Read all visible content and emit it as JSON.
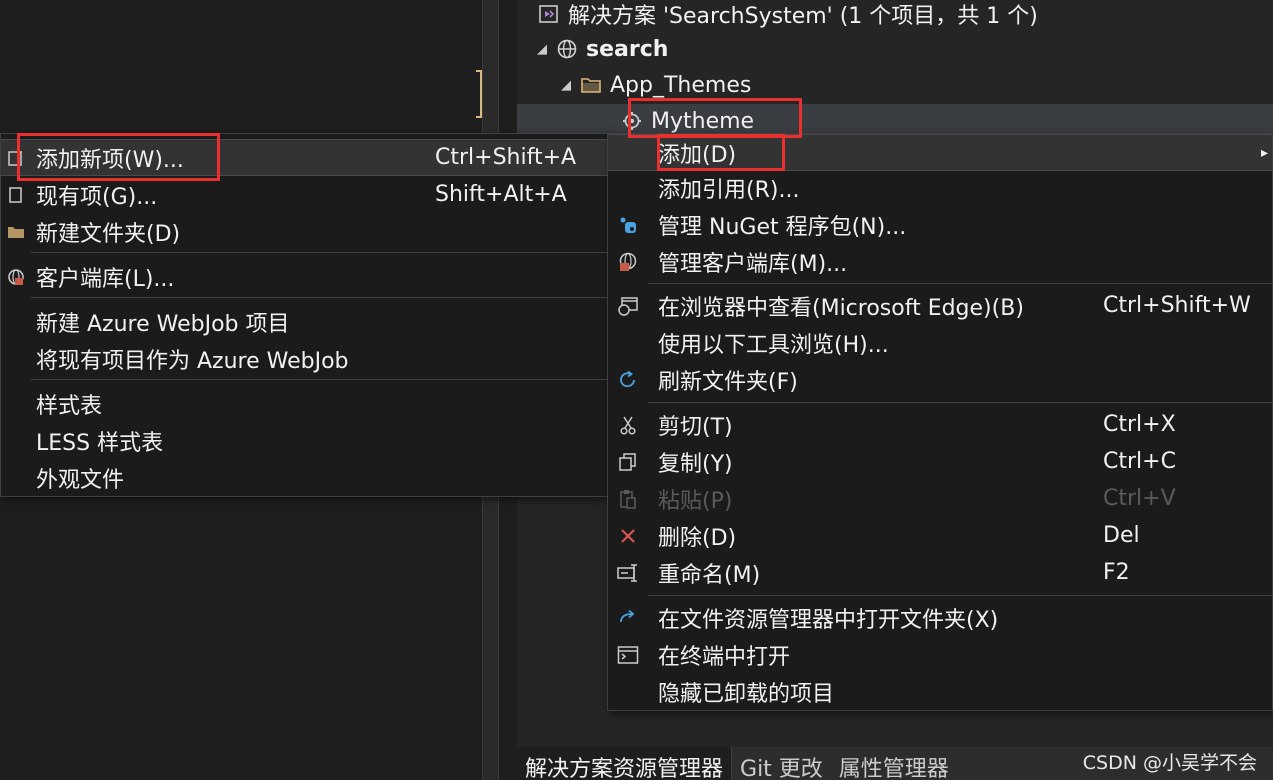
{
  "solution_tree": {
    "solution_label": "解决方案 'SearchSystem' (1 个项目，共 1 个)",
    "project_label": "search",
    "folder_label": "App_Themes",
    "item_label": "Mytheme",
    "expander_glyph": "◢"
  },
  "submenu": {
    "items": [
      {
        "label": "添加新项(W)...",
        "shortcut": "Ctrl+Shift+A",
        "icon": "new-item-icon"
      },
      {
        "label": "现有项(G)...",
        "shortcut": "Shift+Alt+A",
        "icon": "existing-item-icon"
      },
      {
        "label": "新建文件夹(D)",
        "shortcut": "",
        "icon": "folder-icon"
      },
      {
        "label": "客户端库(L)...",
        "shortcut": "",
        "icon": "client-library-icon"
      },
      {
        "label": "新建 Azure WebJob 项目",
        "shortcut": "",
        "icon": ""
      },
      {
        "label": "将现有项目作为 Azure WebJob",
        "shortcut": "",
        "icon": ""
      },
      {
        "label": "样式表",
        "shortcut": "",
        "icon": ""
      },
      {
        "label": "LESS 样式表",
        "shortcut": "",
        "icon": ""
      },
      {
        "label": "外观文件",
        "shortcut": "",
        "icon": ""
      }
    ]
  },
  "context_menu": {
    "items": [
      {
        "label": "添加(D)",
        "shortcut": "",
        "icon": "",
        "has_submenu": true,
        "arrow": "▸"
      },
      {
        "label": "添加引用(R)...",
        "shortcut": "",
        "icon": ""
      },
      {
        "label": "管理 NuGet 程序包(N)...",
        "shortcut": "",
        "icon": "nuget-icon"
      },
      {
        "label": "管理客户端库(M)...",
        "shortcut": "",
        "icon": "client-library-icon"
      },
      {
        "label": "在浏览器中查看(Microsoft Edge)(B)",
        "shortcut": "Ctrl+Shift+W",
        "icon": "browser-view-icon"
      },
      {
        "label": "使用以下工具浏览(H)...",
        "shortcut": "",
        "icon": ""
      },
      {
        "label": "刷新文件夹(F)",
        "shortcut": "",
        "icon": "refresh-icon"
      },
      {
        "label": "剪切(T)",
        "shortcut": "Ctrl+X",
        "icon": "cut-icon"
      },
      {
        "label": "复制(Y)",
        "shortcut": "Ctrl+C",
        "icon": "copy-icon"
      },
      {
        "label": "粘贴(P)",
        "shortcut": "Ctrl+V",
        "icon": "paste-icon",
        "disabled": true
      },
      {
        "label": "删除(D)",
        "shortcut": "Del",
        "icon": "delete-icon"
      },
      {
        "label": "重命名(M)",
        "shortcut": "F2",
        "icon": "rename-icon"
      },
      {
        "label": "在文件资源管理器中打开文件夹(X)",
        "shortcut": "",
        "icon": "open-folder-icon"
      },
      {
        "label": "在终端中打开",
        "shortcut": "",
        "icon": "terminal-icon"
      },
      {
        "label": "隐藏已卸载的项目",
        "shortcut": "",
        "icon": ""
      }
    ]
  },
  "bottom_tabs": [
    {
      "label": "解决方案资源管理器",
      "active": true
    },
    {
      "label": "Git 更改",
      "active": false
    },
    {
      "label": "属性管理器",
      "active": false
    }
  ],
  "watermark": "CSDN @小吴学不会",
  "colors": {
    "highlight_box": "#e8312f",
    "menu_bg": "#1b1b1c",
    "tree_bg": "#252526",
    "accent_blue": "#4aa3df",
    "delete_red": "#e05555"
  }
}
